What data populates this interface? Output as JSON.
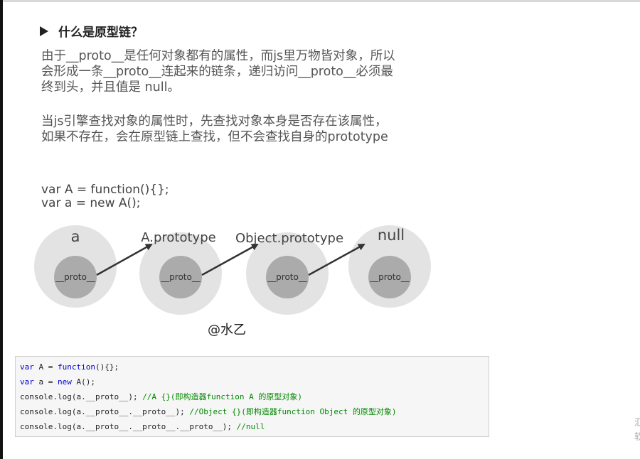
{
  "heading": "什么是原型链？",
  "paragraph1": [
    "由于__proto__是任何对象都有的属性，而js里万物皆对象，所以",
    "会形成一条__proto__连起来的链条，递归访问__proto__必须最",
    "终到头，并且值是 null。"
  ],
  "paragraph2": [
    "当js引擎查找对象的属性时，先查找对象本身是否存在该属性，",
    "如果不存在，会在原型链上查找，但不会查找自身的prototype"
  ],
  "code_sample": [
    "var A = function(){};",
    "var a = new A();"
  ],
  "diagram": {
    "nodes": [
      {
        "label": "a",
        "inner": "__proto__"
      },
      {
        "label": "A.prototype",
        "inner": "__proto__"
      },
      {
        "label": "Object.prototype",
        "inner": "__proto__"
      },
      {
        "label": "null",
        "inner": "__proto__"
      }
    ]
  },
  "watermark": "@水乙",
  "code_block": {
    "line1": {
      "kw1": "var",
      "t1": " A = ",
      "kw2": "function",
      "t2": "(){};"
    },
    "line2": {
      "kw1": "var",
      "t1": " a = ",
      "kw2": "new",
      "t2": " A();"
    },
    "line3": {
      "code": "console.log(a.__proto__); ",
      "comment": "//A {}(即构造器function A 的原型对象)"
    },
    "line4": {
      "code": "console.log(a.__proto__.__proto__); ",
      "comment": "//Object {}(即构造器function Object 的原型对象)"
    },
    "line5": {
      "code": "console.log(a.__proto__.__proto__.__proto__); ",
      "comment": "//null"
    }
  },
  "edge_chars": [
    "汇",
    "软"
  ]
}
